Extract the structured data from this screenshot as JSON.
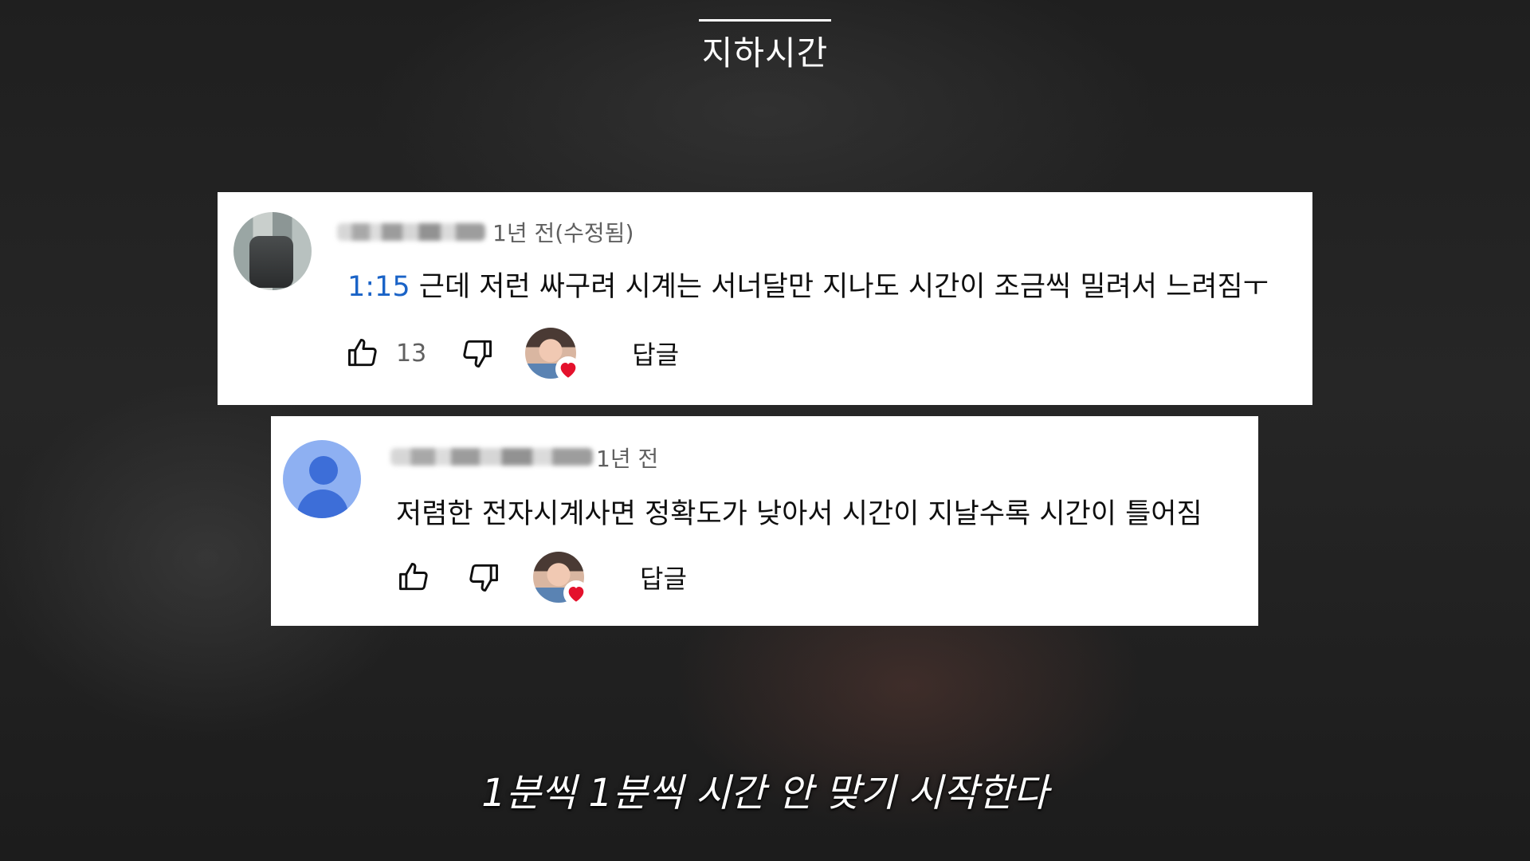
{
  "overlay": {
    "top_title": "지하시간",
    "subtitle": "1분씩 1분씩 시간 안 맞기 시작한다"
  },
  "comments": [
    {
      "time_ago": "1년 전(수정됨)",
      "timestamp": "1:15",
      "text": "근데 저런 싸구려 시계는 서너달만 지나도 시간이 조금씩 밀려서 느려짐ㅜ",
      "likes": "13",
      "reply_label": "답글"
    },
    {
      "time_ago": "1년 전",
      "text": "저렴한 전자시계사면 정확도가 낮아서 시간이 지날수록 시간이 틀어짐",
      "reply_label": "답글"
    }
  ],
  "icons": [
    "thumbs-up-icon",
    "thumbs-down-icon",
    "creator-heart-icon",
    "default-avatar-icon"
  ],
  "colors": {
    "link": "#1a63c7",
    "heart": "#e4112c",
    "default_avatar": "#8eb0f2"
  }
}
